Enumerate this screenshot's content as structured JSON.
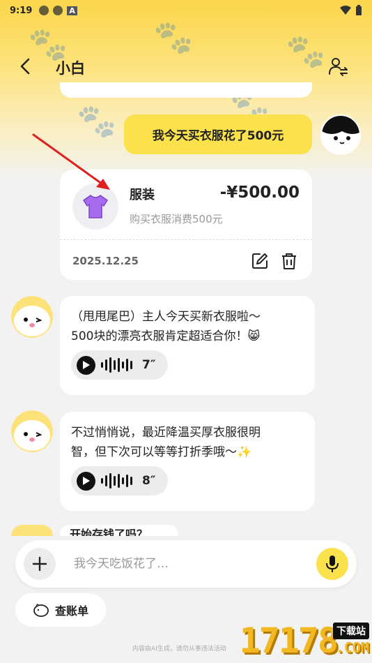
{
  "status_bar": {
    "time": "9:19",
    "icon": "A"
  },
  "header": {
    "title": "小白"
  },
  "user_message": {
    "text": "我今天买衣服花了500元"
  },
  "record": {
    "category": "服装",
    "amount": "-¥500.00",
    "description": "购买衣服消费500元",
    "date": "2025.12.25",
    "icon": "shirt-icon",
    "icon_color": "#a86bf0"
  },
  "ai_messages": [
    {
      "text_line1": "（甩甩尾巴）主人今天买新衣服啦～",
      "text_line2": "500块的漂亮衣服肯定超适合你！😸",
      "duration": "7″"
    },
    {
      "text_line1": "不过悄悄说，最近降温买厚衣服很明",
      "text_line2": "智，但下次可以等等打折季哦～✨",
      "duration": "8″"
    }
  ],
  "partial_message": {
    "text": "开始存钱了吗？"
  },
  "input": {
    "placeholder": "我今天吃饭花了…"
  },
  "ledger_button": {
    "label": "查账单"
  },
  "disclaimer": {
    "text": "内容由AI生成，请勿从事违法活动"
  },
  "watermark": {
    "number": "17178",
    "tag": "下载站",
    "suffix": ".COM"
  },
  "colors": {
    "accent": "#fbe14c",
    "arrow": "#e02020",
    "background": "#f2f2f2"
  }
}
